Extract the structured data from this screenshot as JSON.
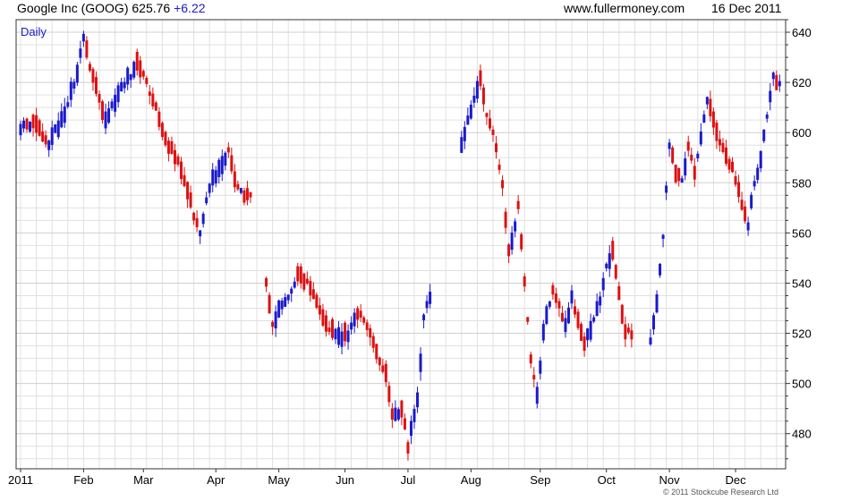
{
  "header": {
    "title": "Google Inc (GOOG) 625.76",
    "change": "+6.22",
    "source": "www.fullermoney.com",
    "date": "16 Dec 2011"
  },
  "copyright": "© 2011 Stockcube Research Ltd",
  "colors": {
    "up": "#1a1acc",
    "down": "#dd1111",
    "grid": "#e0e0e0",
    "frame": "#333333"
  },
  "chart_data": {
    "type": "candlestick",
    "period_label": "Daily",
    "ylim": [
      466,
      645
    ],
    "y_ticks": [
      480,
      500,
      520,
      540,
      560,
      580,
      600,
      620,
      640
    ],
    "x_tick_labels": [
      "2011",
      "Feb",
      "Mar",
      "Apr",
      "May",
      "Jun",
      "Jul",
      "Aug",
      "Sep",
      "Oct",
      "Nov",
      "Dec"
    ],
    "x_tick_index": [
      0,
      20,
      39,
      62,
      82,
      103,
      123,
      143,
      165,
      186,
      206,
      227
    ],
    "n_days": 241,
    "gaps": [
      [
        73,
        78
      ],
      [
        130,
        140
      ],
      [
        194,
        200
      ]
    ],
    "keypoints": [
      [
        0,
        601
      ],
      [
        4,
        604
      ],
      [
        9,
        596
      ],
      [
        13,
        605
      ],
      [
        18,
        622
      ],
      [
        20,
        639
      ],
      [
        22,
        626
      ],
      [
        25,
        614
      ],
      [
        27,
        605
      ],
      [
        32,
        617
      ],
      [
        37,
        628
      ],
      [
        40,
        620
      ],
      [
        43,
        610
      ],
      [
        46,
        597
      ],
      [
        51,
        586
      ],
      [
        55,
        568
      ],
      [
        57,
        560
      ],
      [
        60,
        578
      ],
      [
        63,
        586
      ],
      [
        66,
        592
      ],
      [
        69,
        577
      ],
      [
        73,
        575
      ],
      [
        78,
        540
      ],
      [
        80,
        525
      ],
      [
        83,
        530
      ],
      [
        86,
        538
      ],
      [
        88,
        543
      ],
      [
        91,
        540
      ],
      [
        94,
        532
      ],
      [
        98,
        522
      ],
      [
        101,
        518
      ],
      [
        104,
        520
      ],
      [
        107,
        528
      ],
      [
        109,
        525
      ],
      [
        113,
        513
      ],
      [
        116,
        503
      ],
      [
        118,
        487
      ],
      [
        121,
        490
      ],
      [
        123,
        475
      ],
      [
        126,
        492
      ],
      [
        128,
        525
      ],
      [
        131,
        540
      ],
      [
        133,
        527
      ],
      [
        135,
        537
      ],
      [
        140,
        595
      ],
      [
        143,
        608
      ],
      [
        146,
        622
      ],
      [
        148,
        608
      ],
      [
        151,
        595
      ],
      [
        153,
        578
      ],
      [
        155,
        552
      ],
      [
        158,
        570
      ],
      [
        160,
        540
      ],
      [
        162,
        510
      ],
      [
        164,
        495
      ],
      [
        166,
        520
      ],
      [
        169,
        538
      ],
      [
        171,
        530
      ],
      [
        173,
        522
      ],
      [
        175,
        533
      ],
      [
        177,
        526
      ],
      [
        179,
        517
      ],
      [
        182,
        525
      ],
      [
        184,
        533
      ],
      [
        186,
        548
      ],
      [
        188,
        552
      ],
      [
        190,
        535
      ],
      [
        192,
        522
      ],
      [
        194,
        520
      ],
      [
        196,
        500
      ],
      [
        198,
        488
      ],
      [
        200,
        517
      ],
      [
        202,
        533
      ],
      [
        204,
        557
      ],
      [
        206,
        595
      ],
      [
        208,
        585
      ],
      [
        210,
        580
      ],
      [
        212,
        595
      ],
      [
        214,
        585
      ],
      [
        216,
        598
      ],
      [
        218,
        612
      ],
      [
        220,
        605
      ],
      [
        222,
        595
      ],
      [
        225,
        588
      ],
      [
        227,
        582
      ],
      [
        229,
        570
      ],
      [
        231,
        564
      ],
      [
        233,
        580
      ],
      [
        235,
        590
      ],
      [
        237,
        607
      ],
      [
        239,
        622
      ],
      [
        242,
        620
      ],
      [
        245,
        617
      ],
      [
        247,
        626
      ]
    ]
  }
}
